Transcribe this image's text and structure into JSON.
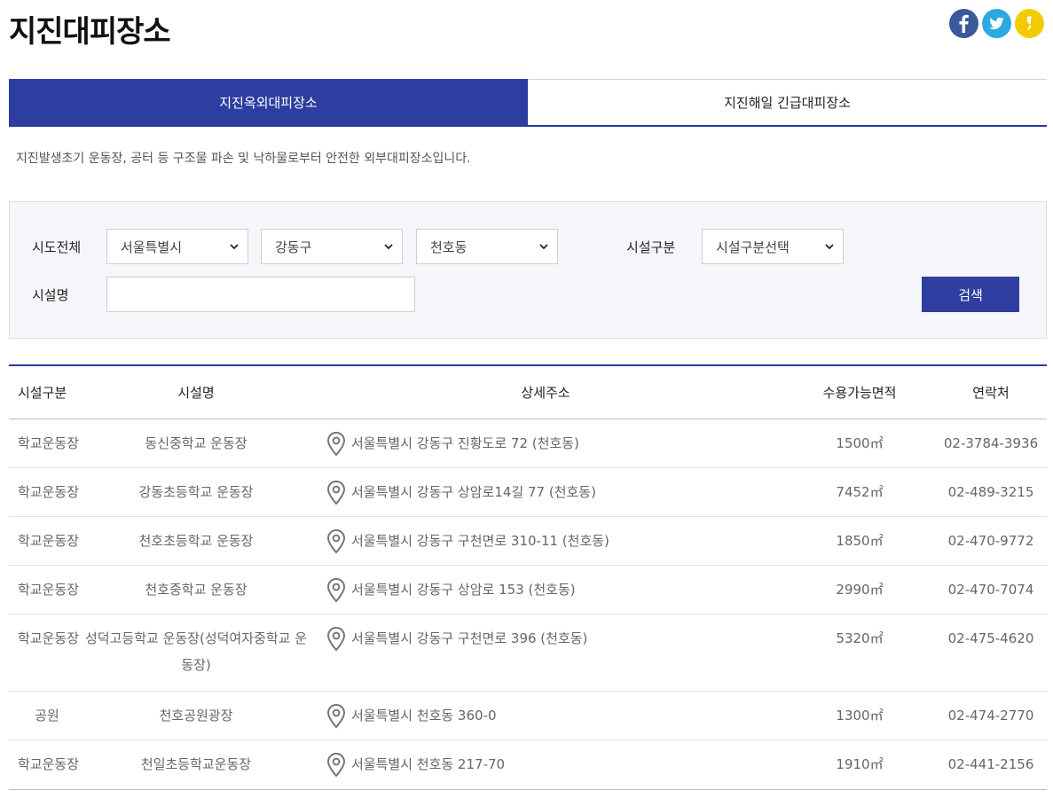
{
  "page": {
    "title": "지진대피장소"
  },
  "social": [
    {
      "name": "facebook",
      "icon": "facebook-icon",
      "color": "#3b5998"
    },
    {
      "name": "twitter",
      "icon": "twitter-icon",
      "color": "#2da9e1"
    },
    {
      "name": "kakaostory",
      "icon": "kakaostory-icon",
      "color": "#f2cc00"
    }
  ],
  "tabs": [
    {
      "label": "지진옥외대피장소",
      "active": true
    },
    {
      "label": "지진해일 긴급대피장소",
      "active": false
    }
  ],
  "description": "지진발생초기 운동장, 공터 등 구조물 파손 및 낙하물로부터 안전한 외부대피장소입니다.",
  "search": {
    "region_label": "시도전체",
    "city_value": "서울특별시",
    "district_value": "강동구",
    "dong_value": "천호동",
    "facility_type_label": "시설구분",
    "facility_type_value": "시설구분선택",
    "facility_name_label": "시설명",
    "facility_name_value": "",
    "search_button": "검색"
  },
  "table": {
    "headers": [
      "시설구분",
      "시설명",
      "상세주소",
      "수용가능면적",
      "연락처"
    ],
    "rows": [
      {
        "type": "학교운동장",
        "name": "동신중학교 운동장",
        "address": "서울특별시 강동구 진황도로 72 (천호동)",
        "area": "1500㎡",
        "phone": "02-3784-3936"
      },
      {
        "type": "학교운동장",
        "name": "강동초등학교 운동장",
        "address": "서울특별시 강동구 상암로14길 77 (천호동)",
        "area": "7452㎡",
        "phone": "02-489-3215"
      },
      {
        "type": "학교운동장",
        "name": "천호초등학교 운동장",
        "address": "서울특별시 강동구 구천면로 310-11 (천호동)",
        "area": "1850㎡",
        "phone": "02-470-9772"
      },
      {
        "type": "학교운동장",
        "name": "천호중학교 운동장",
        "address": "서울특별시 강동구 상암로 153 (천호동)",
        "area": "2990㎡",
        "phone": "02-470-7074"
      },
      {
        "type": "학교운동장",
        "name": "성덕고등학교 운동장(성덕여자중학교 운동장)",
        "address": "서울특별시 강동구 구천면로 396 (천호동)",
        "area": "5320㎡",
        "phone": "02-475-4620"
      },
      {
        "type": "공원",
        "name": "천호공원광장",
        "address": "서울특별시 천호동 360-0",
        "area": "1300㎡",
        "phone": "02-474-2770"
      },
      {
        "type": "학교운동장",
        "name": "천일초등학교운동장",
        "address": "서울특별시 천호동 217-70",
        "area": "1910㎡",
        "phone": "02-441-2156"
      }
    ]
  }
}
